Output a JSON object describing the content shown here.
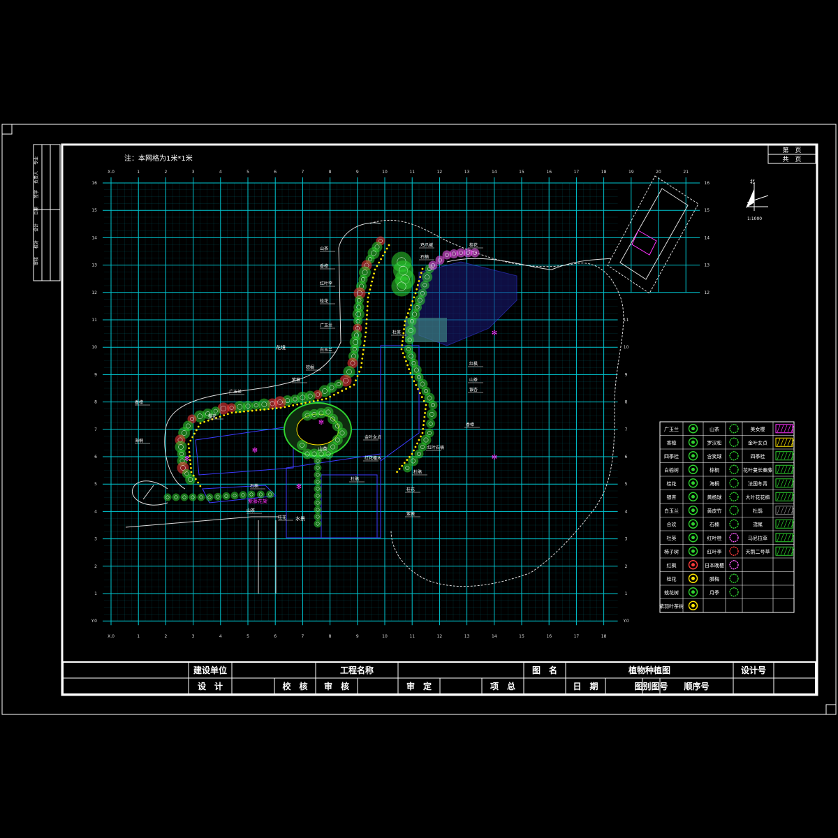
{
  "note": "注：本网格为1米*1米",
  "page_box": {
    "current": "第　页",
    "total": "共　页"
  },
  "north_label": "北",
  "scale_label": "1:1000",
  "grid": {
    "x_top": [
      "X.0",
      "1",
      "2",
      "3",
      "4",
      "5",
      "6",
      "7",
      "8",
      "9",
      "10",
      "11",
      "12",
      "13",
      "14",
      "15",
      "16",
      "17",
      "18",
      "19",
      "20",
      "21"
    ],
    "x_bottom": [
      "X.0",
      "1",
      "2",
      "3",
      "4",
      "5",
      "6",
      "7",
      "8",
      "9",
      "10",
      "11",
      "12",
      "13",
      "14",
      "15",
      "16",
      "17",
      "18"
    ],
    "y_left": [
      "16",
      "15",
      "14",
      "13",
      "12",
      "11",
      "10",
      "9",
      "8",
      "7",
      "6",
      "5",
      "4",
      "3",
      "2",
      "1",
      "Y.0"
    ],
    "y_right_top": [
      "16",
      "15",
      "14",
      "13",
      "12"
    ],
    "y_right_lower": [
      "11",
      "10",
      "9",
      "8",
      "7",
      "6",
      "5",
      "4",
      "3",
      "2",
      "1",
      "Y.0"
    ]
  },
  "plan_labels": [
    "山茶",
    "香樟",
    "红叶李",
    "桂花",
    "广玉兰",
    "白玉兰",
    "棕榈",
    "紫薇",
    "鸡爪槭",
    "石楠",
    "桂花",
    "杜英",
    "红枫",
    "山茶",
    "银杏",
    "香樟",
    "红叶石楠",
    "杜鹃",
    "桂花",
    "紫薇",
    "金叶女贞",
    "红花檵木",
    "杜鹃",
    "石楠",
    "樱花",
    "广玉兰",
    "香樟",
    "海桐",
    "山茶",
    "桂花"
  ],
  "plan_marks": [
    "紫藤花架",
    "花境",
    "水景",
    "山茶"
  ],
  "legend": {
    "col1": [
      "广玉兰",
      "香樟",
      "四季桂",
      "白榆树",
      "桂花",
      "银杏",
      "白玉兰",
      "合欢",
      "杜英",
      "柿子树",
      "红枫",
      "桂花",
      "栽花树",
      "紫羽叶茶树"
    ],
    "col2": [
      "山茶",
      "罗汉松",
      "含笑球",
      "棕榈",
      "海桐",
      "黄杨球",
      "黄皮竹",
      "石楠",
      "红叶桂",
      "红叶李",
      "日本晚樱",
      "腊梅",
      "月季"
    ],
    "col3": [
      "美女樱",
      "金叶女贞",
      "四季桂",
      "花叶蔓长春藤",
      "法国冬青",
      "大叶花花植",
      "杜鹃",
      "鸢尾",
      "马尼拉草",
      "天鹅二号草"
    ]
  },
  "title_block": {
    "r1": [
      "建设单位",
      "",
      "工程名称",
      "",
      "图　名",
      "植物种植图",
      "设计号",
      ""
    ],
    "r2": [
      "设　计",
      "",
      "校　核",
      "审　核",
      "",
      "审　定",
      "",
      "项　总",
      "",
      "日　期",
      "",
      "图别图号",
      "顺序号",
      ""
    ]
  },
  "side_strip": [
    "专业",
    "负责人",
    "签字",
    "日期",
    "设计",
    "校对",
    "审核"
  ],
  "colors": {
    "grid": "#00c8d2",
    "tree": "#2fd22f",
    "shrub": "#ffe600",
    "path": "#ffffff",
    "building": "#3b3bff",
    "accent": "#ff32ff",
    "title_frame": "#ffffff"
  }
}
